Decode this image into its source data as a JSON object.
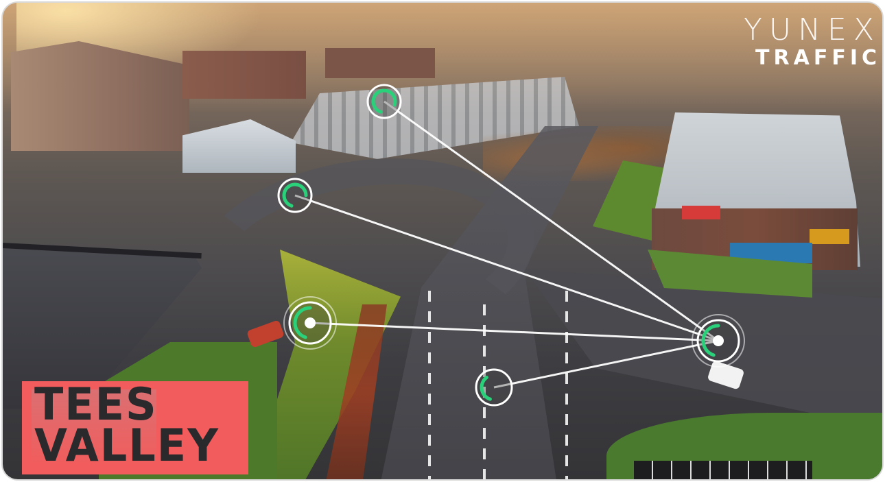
{
  "scene": {
    "description_label": "aerial-road-junction-photo"
  },
  "brand": {
    "line1": "YUNEX",
    "line2": "TRAFFIC"
  },
  "logo_badge": {
    "line1": "TEES",
    "line2": "VALLEY",
    "background_color": "#f25c5c",
    "text_color": "#2a2a2d"
  },
  "network": {
    "accent_color": "#2bd17a",
    "line_color": "#ffffff",
    "hub_node": "node-hub",
    "nodes": [
      {
        "id": "node-top",
        "progress": 0.75
      },
      {
        "id": "node-upper-left",
        "progress": 0.7
      },
      {
        "id": "node-left",
        "progress": 0.45
      },
      {
        "id": "node-hub",
        "progress": 0.45
      },
      {
        "id": "node-bottom",
        "progress": 0.35
      }
    ]
  }
}
